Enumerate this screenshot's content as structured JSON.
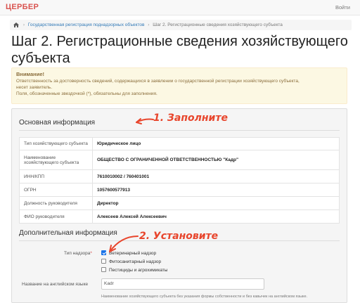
{
  "navbar": {
    "brand": "ЦЕРБЕР",
    "login": "Войти"
  },
  "breadcrumb": {
    "link": "Государственная регистрация поднадзорных объектов",
    "active": "Шаг 2. Регистрационные сведения хозяйствующего субъекта"
  },
  "page": {
    "title": "Шаг 2. Регистрационные сведения хозяйствующего субъекта"
  },
  "alert": {
    "title": "Внимание!",
    "line1": "Ответственность за достоверность сведений, содержащихся в заявлении о государственной регистрации хозяйствующего субъекта,",
    "line2": "несет заявитель.",
    "line3": "Поля, обозначенные звездочкой (*), обязательны для заполнения."
  },
  "main_info": {
    "title": "Основная информация",
    "rows": [
      {
        "label": "Тип хозяйствующего субъекта",
        "value": "Юридическое лицо"
      },
      {
        "label": "Наименование хозяйствующего субъекта",
        "value": "ОБЩЕСТВО С ОГРАНИЧЕННОЙ ОТВЕТСТВЕННОСТЬЮ \"Кадр\""
      },
      {
        "label": "ИНН/КПП",
        "value": "7610010002 / 760401001"
      },
      {
        "label": "ОГРН",
        "value": "1057600577913"
      },
      {
        "label": "Должность руководителя",
        "value": "Директор"
      },
      {
        "label": "ФИО руководителя",
        "value": "Алексеев Алексей Алексеевич"
      }
    ]
  },
  "additional_info": {
    "title": "Дополнительная информация",
    "supervision_label": "Тип надзора",
    "required_mark": "*",
    "options": [
      {
        "label": "Ветеринарный надзор",
        "checked": true
      },
      {
        "label": "Фитосанитарный надзор",
        "checked": false
      },
      {
        "label": "Пестициды и агрохимикаты",
        "checked": false
      }
    ],
    "english_name_label": "Название на английском языке",
    "english_name_value": "Kadr",
    "english_name_help": "Наименование хозяйствующего субъекта без указания формы собственности и без кавычек на английском языке."
  },
  "annotations": {
    "step1": "1. Заполните",
    "step2": "2. Установите",
    "color": "#e8452c"
  }
}
